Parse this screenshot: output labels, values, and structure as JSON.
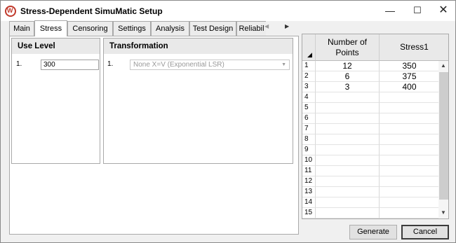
{
  "window": {
    "title": "Stress-Dependent SimuMatic Setup",
    "minimize": "—",
    "maximize": "☐",
    "close": "✕"
  },
  "tabs": [
    {
      "label": "Main"
    },
    {
      "label": "Stress"
    },
    {
      "label": "Censoring"
    },
    {
      "label": "Settings"
    },
    {
      "label": "Analysis"
    },
    {
      "label": "Test Design"
    },
    {
      "label": "Reliabil"
    }
  ],
  "tab_scroll": {
    "left": "◀",
    "right": "▶"
  },
  "use_level": {
    "heading": "Use Level",
    "rows": [
      {
        "index": "1.",
        "value": "300"
      }
    ]
  },
  "transformation": {
    "heading": "Transformation",
    "rows": [
      {
        "index": "1.",
        "value": "None X=V (Exponential LSR)",
        "arrow": "▼"
      }
    ]
  },
  "grid": {
    "headers": [
      "Number of Points",
      "Stress1"
    ],
    "rows": [
      {
        "n": "1",
        "points": "12",
        "stress": "350"
      },
      {
        "n": "2",
        "points": "6",
        "stress": "375"
      },
      {
        "n": "3",
        "points": "3",
        "stress": "400"
      },
      {
        "n": "4",
        "points": "",
        "stress": ""
      },
      {
        "n": "5",
        "points": "",
        "stress": ""
      },
      {
        "n": "6",
        "points": "",
        "stress": ""
      },
      {
        "n": "7",
        "points": "",
        "stress": ""
      },
      {
        "n": "8",
        "points": "",
        "stress": ""
      },
      {
        "n": "9",
        "points": "",
        "stress": ""
      },
      {
        "n": "10",
        "points": "",
        "stress": ""
      },
      {
        "n": "11",
        "points": "",
        "stress": ""
      },
      {
        "n": "12",
        "points": "",
        "stress": ""
      },
      {
        "n": "13",
        "points": "",
        "stress": ""
      },
      {
        "n": "14",
        "points": "",
        "stress": ""
      },
      {
        "n": "15",
        "points": "",
        "stress": ""
      }
    ],
    "scroll_up": "▲",
    "scroll_down": "▼",
    "corner": "◢"
  },
  "buttons": {
    "generate": "Generate",
    "cancel": "Cancel"
  }
}
